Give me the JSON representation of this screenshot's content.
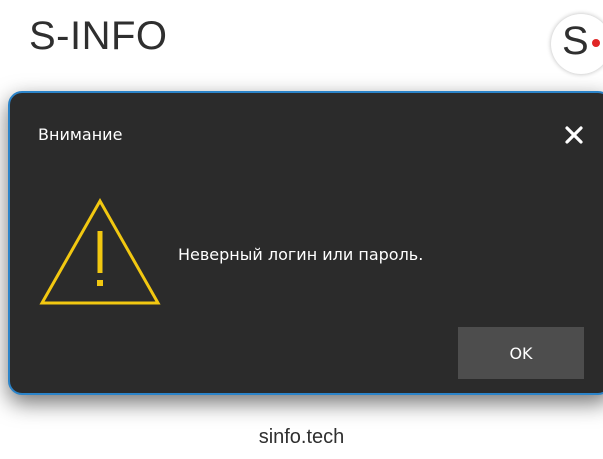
{
  "app": {
    "title": "S-INFO",
    "logo_letter": "S",
    "footer_text": "sinfo.tech"
  },
  "dialog": {
    "title": "Внимание",
    "message": "Неверный логин или пароль.",
    "ok_label": "OK",
    "icon": "warning-icon",
    "close_icon": "close-icon"
  },
  "colors": {
    "dialog_background": "#2b2b2b",
    "dialog_border": "#2c84c9",
    "warning": "#f2c811",
    "button_background": "#4d4d4d",
    "logo_dot": "#e02626"
  }
}
